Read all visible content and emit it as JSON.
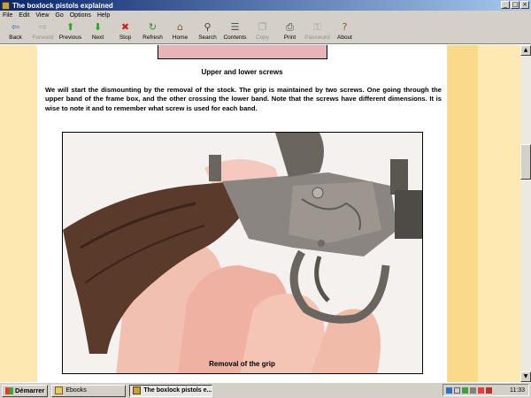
{
  "window": {
    "title": "The boxlock pistols explained"
  },
  "menu": [
    "File",
    "Edit",
    "View",
    "Go",
    "Options",
    "Help"
  ],
  "toolbar": [
    {
      "label": "Back",
      "icon": "back-icon",
      "glyph": "⇦",
      "color": "#2a6fb8",
      "enabled": true
    },
    {
      "label": "Forward",
      "icon": "forward-icon",
      "glyph": "⇨",
      "color": "#a0a0a0",
      "enabled": false
    },
    {
      "label": "Previous",
      "icon": "previous-icon",
      "glyph": "⬆",
      "color": "#2aa02a",
      "enabled": true
    },
    {
      "label": "Next",
      "icon": "next-icon",
      "glyph": "⬇",
      "color": "#2aa02a",
      "enabled": true
    },
    {
      "label": "Stop",
      "icon": "stop-icon",
      "glyph": "✖",
      "color": "#d02020",
      "enabled": true
    },
    {
      "label": "Refresh",
      "icon": "refresh-icon",
      "glyph": "↻",
      "color": "#3a8a3a",
      "enabled": true
    },
    {
      "label": "Home",
      "icon": "home-icon",
      "glyph": "⌂",
      "color": "#806030",
      "enabled": true
    },
    {
      "label": "Search",
      "icon": "search-icon",
      "glyph": "⚲",
      "color": "#404040",
      "enabled": true
    },
    {
      "label": "Contents",
      "icon": "contents-icon",
      "glyph": "☰",
      "color": "#505050",
      "enabled": true
    },
    {
      "label": "Copy",
      "icon": "copy-icon",
      "glyph": "❐",
      "color": "#a0a0a0",
      "enabled": false
    },
    {
      "label": "Print",
      "icon": "print-icon",
      "glyph": "⎙",
      "color": "#404040",
      "enabled": true
    },
    {
      "label": "Password",
      "icon": "password-icon",
      "glyph": "⚿",
      "color": "#a0a0a0",
      "enabled": false
    },
    {
      "label": "About",
      "icon": "about-icon",
      "glyph": "?",
      "color": "#806020",
      "enabled": true
    }
  ],
  "page": {
    "caption_top": "Upper and lower screws",
    "paragraph": "We will start the dismounting by the removal of the stock. The grip is maintained by two screws. One going through the upper band of the frame box, and the other crossing the lower band. Note that the screws have different dimensions. It is wise to note it and to remember what screw is used for each band.",
    "caption_bottom": "Removal of the grip"
  },
  "taskbar": {
    "start_label": "Démarrer",
    "tasks": [
      {
        "label": "Ebooks",
        "active": false
      },
      {
        "label": "The boxlock pistols e...",
        "active": true
      }
    ],
    "clock": "11:33"
  },
  "colors": {
    "titlebar": "#0a246a",
    "background_band": "#fde9b1",
    "accent_band": "#fbd98a"
  }
}
